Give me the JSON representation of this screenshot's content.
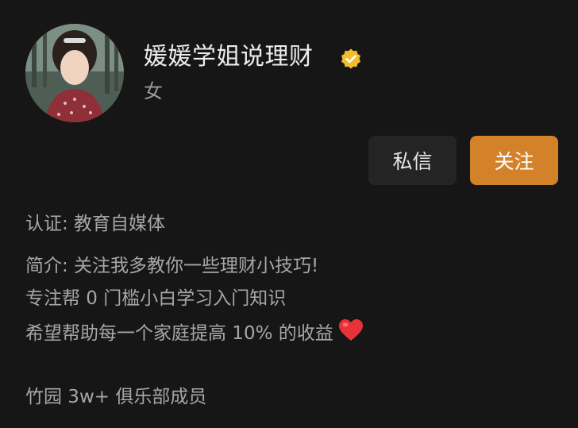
{
  "profile": {
    "display_name": "媛媛学姐说理财",
    "gender": "女",
    "verified_icon": "verified-badge-icon",
    "avatar": "profile-avatar"
  },
  "actions": {
    "message_label": "私信",
    "follow_label": "关注"
  },
  "info": {
    "certification": "认证: 教育自媒体",
    "intro_line1": "简介: 关注我多教你一些理财小技巧!",
    "intro_line2": "专注帮 0 门槛小白学习入门知识",
    "intro_line3": "希望帮助每一个家庭提高 10% 的收益",
    "intro_line3_icon": "red-heart-icon",
    "club_line": "竹园 3w+ 俱乐部成员"
  },
  "colors": {
    "background": "#161616",
    "follow_button": "#d4822a",
    "message_button": "#242424",
    "verified_badge": "#f2bd2b",
    "heart": "#e8323a"
  }
}
